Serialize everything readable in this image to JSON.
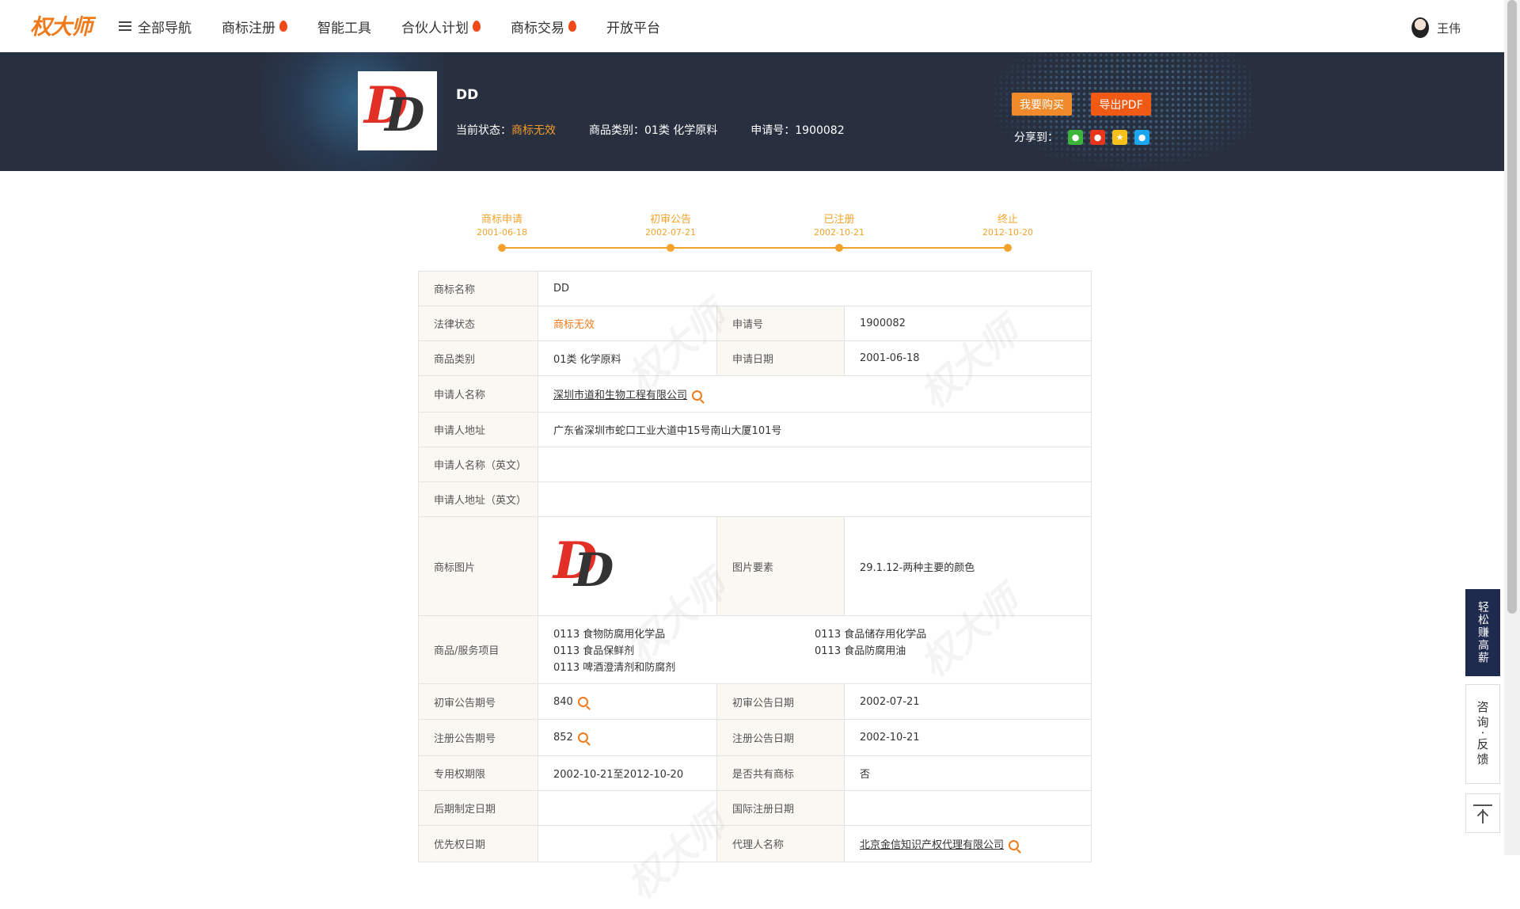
{
  "nav": {
    "logo": "权大师",
    "items": [
      {
        "label": "全部导航",
        "icon": "menu-icon"
      },
      {
        "label": "商标注册",
        "hot": true
      },
      {
        "label": "智能工具",
        "hot": false
      },
      {
        "label": "合伙人计划",
        "hot": true
      },
      {
        "label": "商标交易",
        "hot": true
      },
      {
        "label": "开放平台",
        "hot": false
      }
    ],
    "user_name": "王伟"
  },
  "banner": {
    "title": "DD",
    "status_label": "当前状态：",
    "status_value": "商标无效",
    "category_text": "商品类别：01类 化学原料",
    "app_no_text": "申请号：1900082",
    "buy_button": "我要购买",
    "pdf_button": "导出PDF",
    "share_label": "分享到：",
    "share_icons": [
      "wechat-icon",
      "weibo-icon",
      "qzone-icon",
      "qq-icon"
    ]
  },
  "logo_mark": {
    "red": "D",
    "black": "D"
  },
  "timeline": [
    {
      "label": "商标申请",
      "date": "2001-06-18"
    },
    {
      "label": "初审公告",
      "date": "2002-07-21"
    },
    {
      "label": "已注册",
      "date": "2002-10-21"
    },
    {
      "label": "终止",
      "date": "2012-10-20"
    }
  ],
  "table": {
    "name_k": "商标名称",
    "name_v": "DD",
    "legal_k": "法律状态",
    "legal_v": "商标无效",
    "appno_k": "申请号",
    "appno_v": "1900082",
    "class_k": "商品类别",
    "class_v": "01类 化学原料",
    "appdate_k": "申请日期",
    "appdate_v": "2001-06-18",
    "applicant_k": "申请人名称",
    "applicant_v": "深圳市道和生物工程有限公司",
    "addr_k": "申请人地址",
    "addr_v": "广东省深圳市蛇口工业大道中15号南山大厦101号",
    "applicant_en_k": "申请人名称（英文）",
    "applicant_en_v": "",
    "addr_en_k": "申请人地址（英文）",
    "addr_en_v": "",
    "image_k": "商标图片",
    "elements_k": "图片要素",
    "elements_v": "29.1.12-两种主要的颜色",
    "goods_k": "商品/服务项目",
    "goods": [
      "0113 食物防腐用化学品",
      "0113 食品储存用化学品",
      "0113 食品保鲜剂",
      "0113 食品防腐用油",
      "0113 啤酒澄清剂和防腐剂"
    ],
    "prelim_no_k": "初审公告期号",
    "prelim_no_v": "840",
    "prelim_date_k": "初审公告日期",
    "prelim_date_v": "2002-07-21",
    "reg_no_k": "注册公告期号",
    "reg_no_v": "852",
    "reg_date_k": "注册公告日期",
    "reg_date_v": "2002-10-21",
    "term_k": "专用权期限",
    "term_v": "2002-10-21至2012-10-20",
    "shared_k": "是否共有商标",
    "shared_v": "否",
    "later_k": "后期制定日期",
    "later_v": "",
    "intl_k": "国际注册日期",
    "intl_v": "",
    "priority_k": "优先权日期",
    "priority_v": "",
    "agent_k": "代理人名称",
    "agent_v": "北京金信知识产权代理有限公司"
  },
  "watermark": "权大师",
  "side": {
    "earn": "轻松赚高薪",
    "consult": "咨询·反馈"
  },
  "colors": {
    "accent": "#f07a1a",
    "banner_bg": "#283040",
    "timeline": "#f3a32d",
    "side_dark": "#1e2a4e"
  }
}
